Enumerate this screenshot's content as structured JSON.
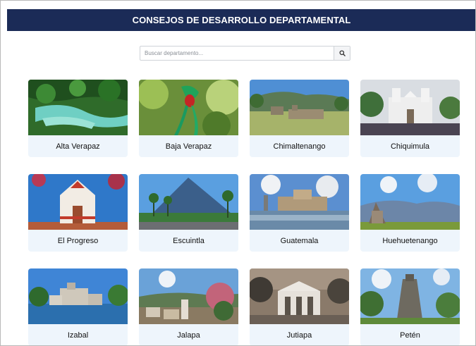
{
  "header": {
    "title": "CONSEJOS DE DESARROLLO DEPARTAMENTAL"
  },
  "search": {
    "placeholder": "Buscar departamento...",
    "value": "",
    "icon": "search-icon"
  },
  "departments": [
    {
      "name": "Alta Verapaz"
    },
    {
      "name": "Baja Verapaz"
    },
    {
      "name": "Chimaltenango"
    },
    {
      "name": "Chiquimula"
    },
    {
      "name": "El Progreso"
    },
    {
      "name": "Escuintla"
    },
    {
      "name": "Guatemala"
    },
    {
      "name": "Huehuetenango"
    },
    {
      "name": "Izabal"
    },
    {
      "name": "Jalapa"
    },
    {
      "name": "Jutiapa"
    },
    {
      "name": "Petén"
    }
  ],
  "colors": {
    "header_bg": "#1b2b57",
    "card_label_bg": "#eef5fc"
  }
}
